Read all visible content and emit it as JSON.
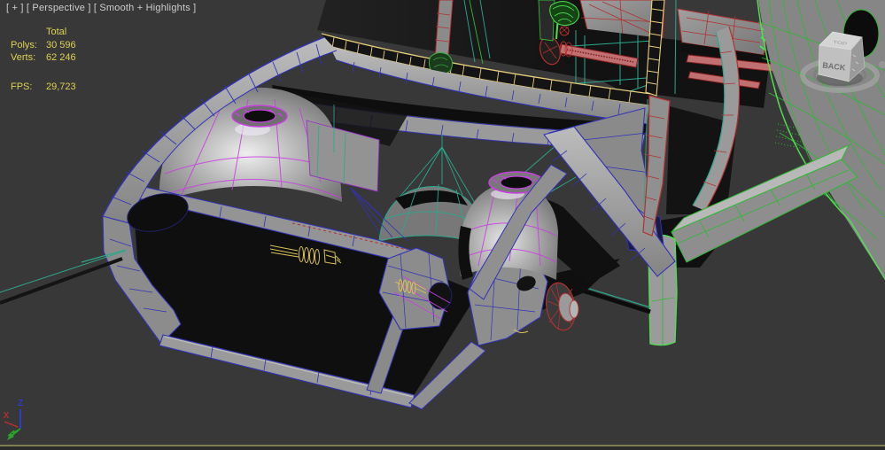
{
  "viewport": {
    "label": "[ + ] [ Perspective ] [ Smooth + Highlights ]",
    "statistics": {
      "header": "Total",
      "rows": [
        {
          "label": "Polys:",
          "value": "30 596"
        },
        {
          "label": "Verts:",
          "value": "62 246"
        }
      ],
      "fps": {
        "label": "FPS:",
        "value": "29,723"
      }
    },
    "viewcube": {
      "front_face": "BACK",
      "top_face": "TOP"
    },
    "axis_gizmo": {
      "z": "Z",
      "x": "X"
    }
  },
  "colors": {
    "bg": "#383838",
    "border_olive": "#7e7e50",
    "border_dark": "#2b2b2b",
    "label_text": "#cdcdcd",
    "stats_text": "#ddd152",
    "wire_blue": "#3232b8",
    "wire_blue_dark": "#20206e",
    "wire_purple": "#9a30c8",
    "wire_magenta": "#c840e0",
    "wire_teal": "#2ba88c",
    "wire_green": "#2fb932",
    "wire_green_bright": "#52dd52",
    "wire_red": "#b33030",
    "wire_red_dark": "#8a2020",
    "rail_pink": "#c07070",
    "wire_yellow": "#e6cf7e",
    "bolt_yellow": "#d8c258",
    "gray_fill": "#8f8f8f",
    "gray_light": "#b6b6b6",
    "gray_dark": "#6c6c6c",
    "black_fill": "#111111",
    "axis_x": "#b03030",
    "axis_y": "#2aa52a",
    "axis_z": "#2c3cc8",
    "cube_top": "#d4d4d4",
    "cube_front": "#c0c0c0",
    "cube_side": "#9a9a9a",
    "cube_text": "#6f6f6f"
  }
}
